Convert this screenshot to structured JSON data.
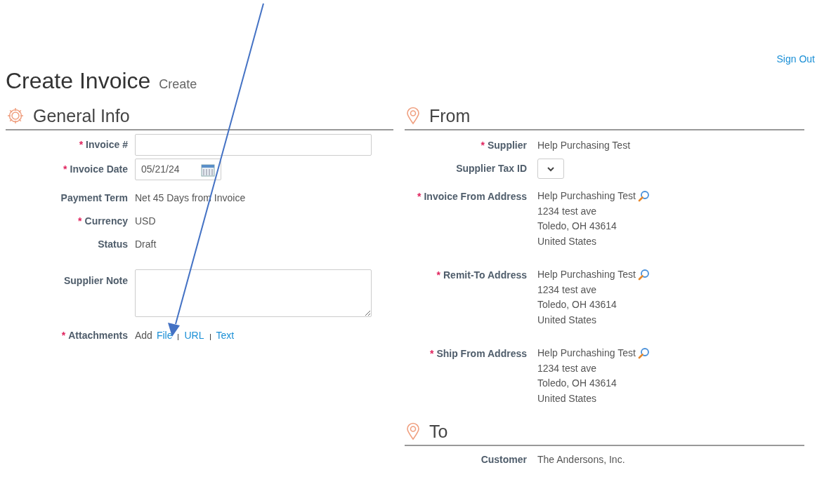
{
  "sign_out": "Sign Out",
  "title": "Create Invoice",
  "subtitle": "Create",
  "general_info": {
    "heading": "General Info",
    "fields": [
      {
        "kind": "input",
        "label": "Invoice #",
        "required_mark": "*"
      },
      {
        "kind": "date",
        "label": "Invoice Date",
        "required_mark": "*",
        "value": "05/21/24"
      },
      {
        "kind": "text",
        "label": "Payment Term",
        "value": "Net 45 Days from Invoice"
      },
      {
        "kind": "text",
        "label": "Currency",
        "required_mark": "*",
        "value": "USD"
      },
      {
        "kind": "text",
        "label": "Status",
        "value": "Draft"
      },
      {
        "kind": "textarea",
        "label": "Supplier Note"
      },
      {
        "kind": "links",
        "label": "Attachments",
        "required_mark": "*",
        "prefix": "Add",
        "links": [
          "File",
          "URL",
          "Text"
        ]
      }
    ]
  },
  "from": {
    "heading": "From",
    "fields": [
      {
        "kind": "text",
        "label": "Supplier",
        "required_mark": "*",
        "value": "Help Purchasing Test"
      },
      {
        "kind": "select",
        "label": "Supplier Tax ID"
      },
      {
        "kind": "address",
        "label": "Invoice From Address",
        "required_mark": "*",
        "lines": [
          "Help Purchashing Test",
          "1234 test ave",
          "Toledo, OH 43614",
          "United States"
        ]
      },
      {
        "kind": "address",
        "label": "Remit-To Address",
        "required_mark": "*",
        "lines": [
          "Help Purchashing Test",
          "1234 test ave",
          "Toledo, OH 43614",
          "United States"
        ]
      },
      {
        "kind": "address",
        "label": "Ship From Address",
        "required_mark": "*",
        "lines": [
          "Help Purchashing Test",
          "1234 test ave",
          "Toledo, OH 43614",
          "United States"
        ]
      }
    ]
  },
  "to": {
    "heading": "To",
    "fields": [
      {
        "kind": "text",
        "label": "Customer",
        "value": "The Andersons, Inc."
      }
    ]
  }
}
